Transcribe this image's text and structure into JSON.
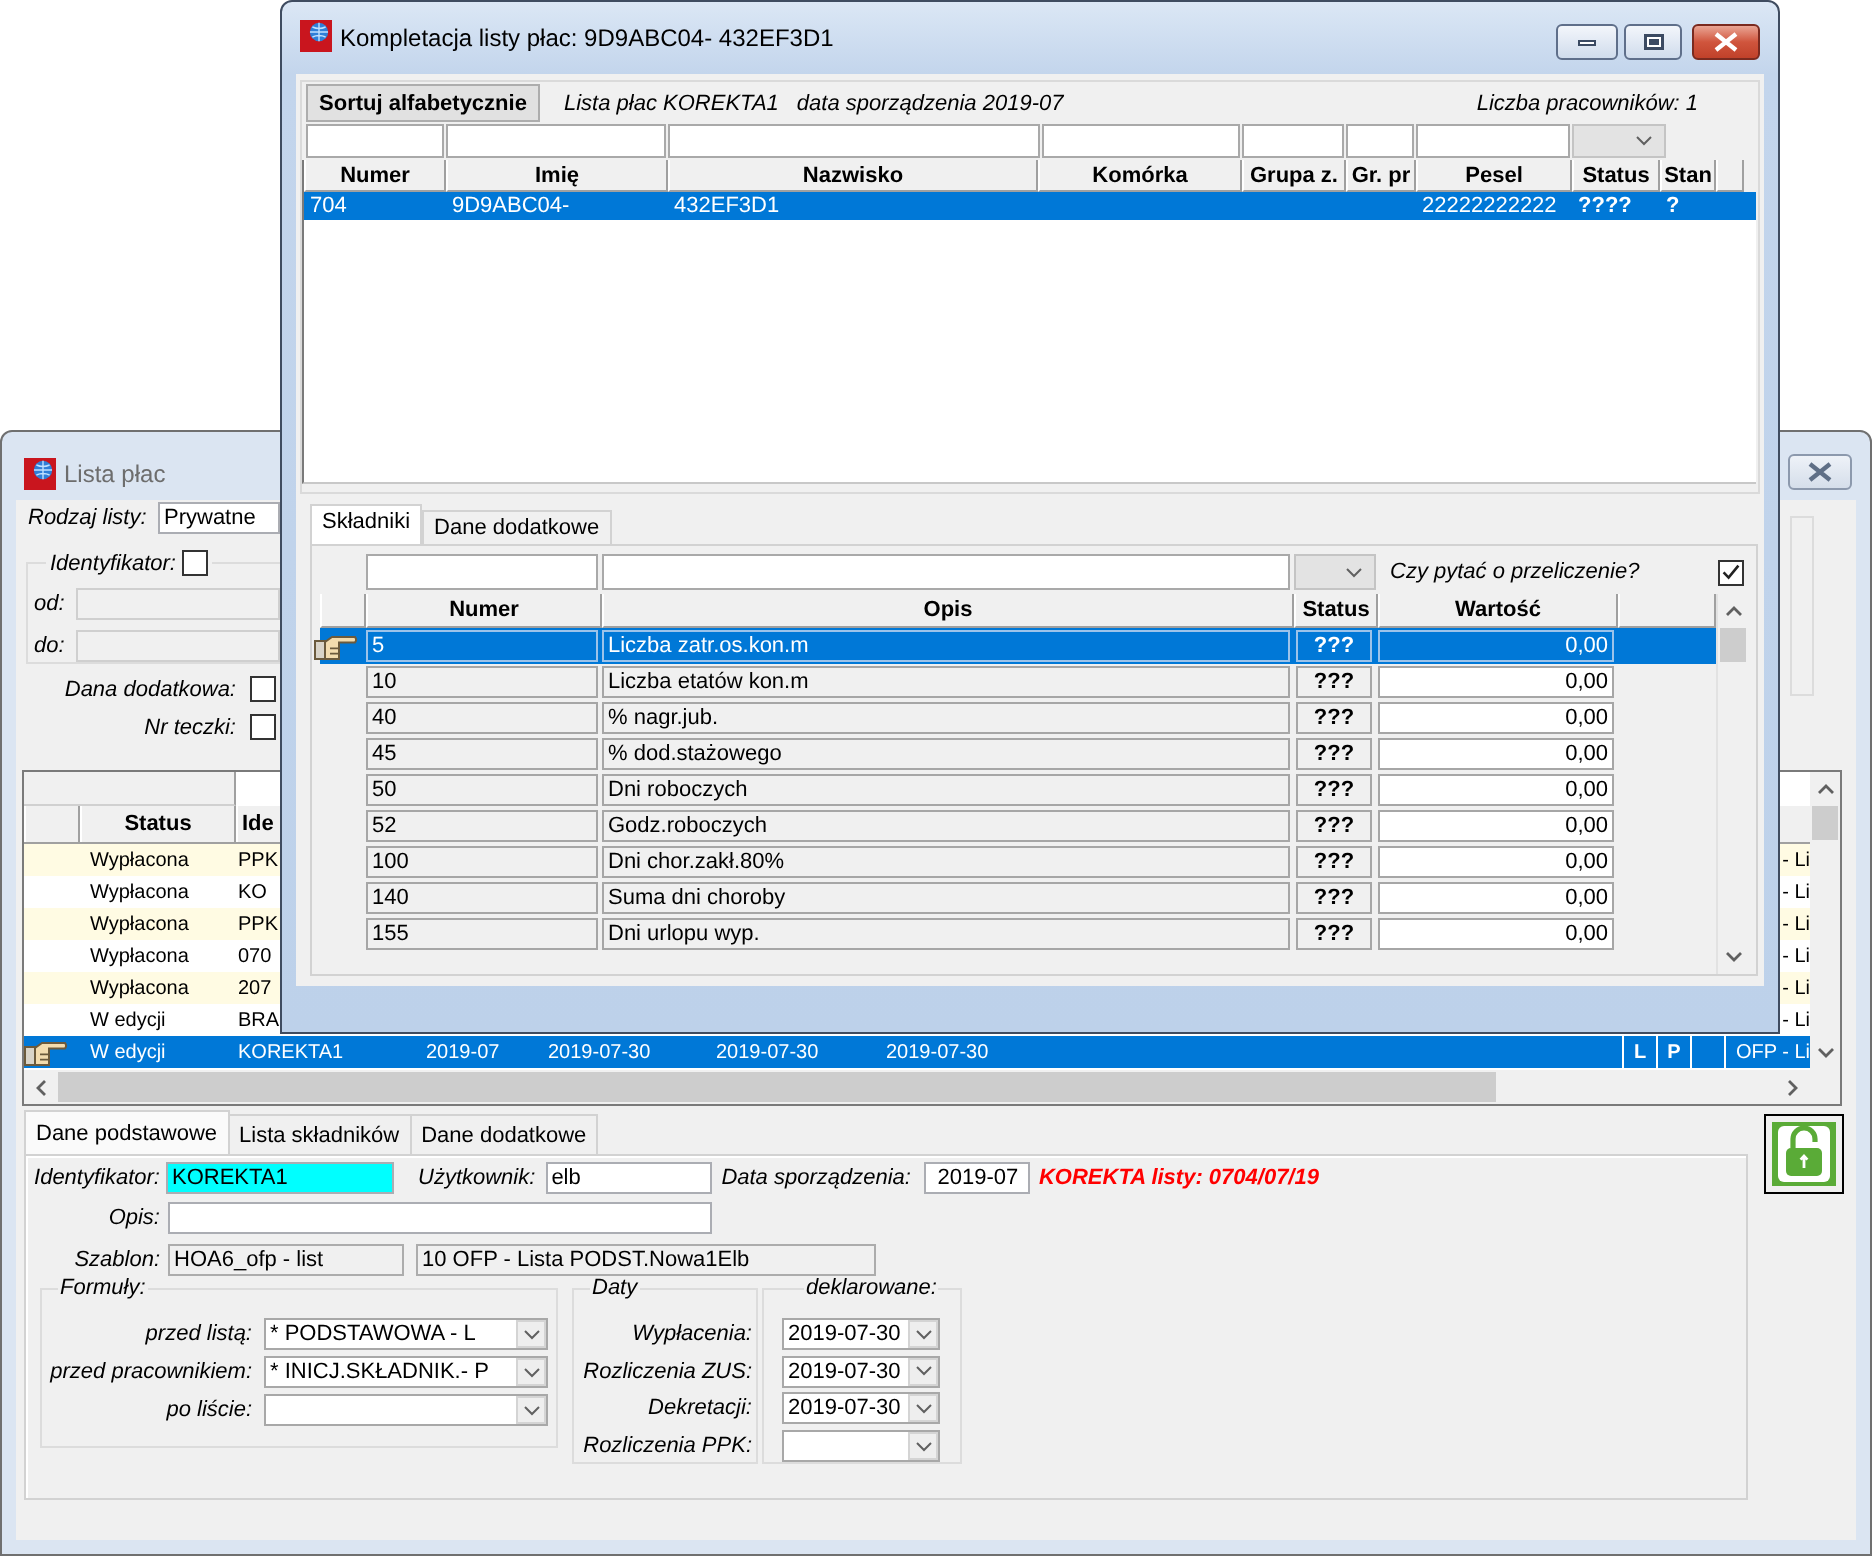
{
  "background_window": {
    "title": "Lista płac",
    "filters": {
      "list_type": {
        "label": "Rodzaj listy:",
        "value": "Prywatne"
      },
      "identifier": {
        "label": "Identyfikator:",
        "checked": false
      },
      "range": [
        {
          "label": "od:"
        },
        {
          "label": "do:"
        }
      ],
      "options": [
        {
          "label": "Dana dodatkowa:",
          "checked": false
        },
        {
          "label": "Nr teczki:",
          "checked": false
        }
      ]
    },
    "table": {
      "columns": [
        "Status",
        "Ide"
      ],
      "rows": [
        {
          "selected": false,
          "cells": [
            "Wypłacona",
            "PPK"
          ],
          "tail": "- Li"
        },
        {
          "selected": false,
          "cells": [
            "Wypłacona",
            "KO"
          ],
          "tail": "- Li"
        },
        {
          "selected": false,
          "cells": [
            "Wypłacona",
            "PPK"
          ],
          "tail": "- Li"
        },
        {
          "selected": false,
          "cells": [
            "Wypłacona",
            "070"
          ],
          "tail": "- Li"
        },
        {
          "selected": false,
          "cells": [
            "Wypłacona",
            "207"
          ],
          "tail": "- Li"
        },
        {
          "selected": false,
          "cells": [
            "W edycji",
            "BRA"
          ],
          "tail": "- Li"
        },
        {
          "selected": true,
          "cells": [
            "W edycji",
            "KOREKTA1",
            "2019-07",
            "2019-07-30",
            "2019-07-30",
            "2019-07-30"
          ],
          "flags": [
            "L",
            "P"
          ],
          "tail": "OFP - Li"
        }
      ]
    },
    "tabs": [
      {
        "label": "Dane podstawowe",
        "selected": true
      },
      {
        "label": "Lista składników",
        "selected": false
      },
      {
        "label": "Dane dodatkowe",
        "selected": false
      }
    ],
    "form": {
      "identifier": {
        "label": "Identyfikator:",
        "value": "KOREKTA1"
      },
      "user": {
        "label": "Użytkownik:",
        "value": "elb"
      },
      "created": {
        "label": "Data sporządzenia:",
        "value": "2019-07"
      },
      "correction_note": "KOREKTA listy: 0704/07/19",
      "description": {
        "label": "Opis:"
      },
      "template": {
        "label": "Szablon:",
        "values": [
          "HOA6_ofp - list",
          "10 OFP - Lista PODST.Nowa1Elb"
        ]
      },
      "formulas": {
        "title": "Formuły:",
        "fields": [
          {
            "label": "przed listą:",
            "value": "* PODSTAWOWA - L"
          },
          {
            "label": "przed pracownikiem:",
            "value": "* INICJ.SKŁADNIK.- P"
          },
          {
            "label": "po liście:"
          }
        ]
      },
      "dates": {
        "title": "Daty",
        "declared_title": "deklarowane:",
        "fields": [
          {
            "label": "Wypłacenia:",
            "value": "2019-07-30"
          },
          {
            "label": "Rozliczenia ZUS:",
            "value": "2019-07-30"
          },
          {
            "label": "Dekretacji:",
            "value": "2019-07-30"
          },
          {
            "label": "Rozliczenia PPK:"
          }
        ]
      }
    },
    "lock": {
      "locked": false
    }
  },
  "dialog": {
    "title": "Kompletacja listy płac: 9D9ABC04- 432EF3D1",
    "sort_button": "Sortuj alfabetycznie",
    "list_info": [
      "Lista płac KOREKTA1",
      "data sporządzenia 2019-07"
    ],
    "employee_count": "Liczba pracowników: 1",
    "employees": {
      "columns": [
        "Numer",
        "Imię",
        "Nazwisko",
        "Komórka",
        "Grupa z.",
        "Gr. pr",
        "Pesel",
        "Status",
        "Stan"
      ],
      "rows": [
        {
          "selected": true,
          "cells": [
            "704",
            "9D9ABC04-",
            "432EF3D1",
            null,
            null,
            null,
            "22222222222",
            "????",
            "?"
          ]
        }
      ]
    },
    "tabs": [
      {
        "label": "Składniki",
        "selected": true
      },
      {
        "label": "Dane dodatkowe",
        "selected": false
      }
    ],
    "recalculate_prompt": {
      "label": "Czy pytać o przeliczenie?",
      "checked": true
    },
    "components": {
      "columns": [
        "Numer",
        "Opis",
        "Status",
        "Wartość"
      ],
      "rows": [
        {
          "selected": true,
          "cells": [
            "5",
            "Liczba zatr.os.kon.m",
            "???",
            "0,00"
          ]
        },
        {
          "selected": false,
          "cells": [
            "10",
            "Liczba etatów kon.m",
            "???",
            "0,00"
          ]
        },
        {
          "selected": false,
          "cells": [
            "40",
            "% nagr.jub.",
            "???",
            "0,00"
          ]
        },
        {
          "selected": false,
          "cells": [
            "45",
            "% dod.stażowego",
            "???",
            "0,00"
          ]
        },
        {
          "selected": false,
          "cells": [
            "50",
            "Dni roboczych",
            "???",
            "0,00"
          ]
        },
        {
          "selected": false,
          "cells": [
            "52",
            "Godz.roboczych",
            "???",
            "0,00"
          ]
        },
        {
          "selected": false,
          "cells": [
            "100",
            "Dni chor.zakł.80%",
            "???",
            "0,00"
          ]
        },
        {
          "selected": false,
          "cells": [
            "140",
            "Suma dni choroby",
            "???",
            "0,00"
          ]
        },
        {
          "selected": false,
          "cells": [
            "155",
            "Dni urlopu wyp.",
            "???",
            "0,00"
          ]
        }
      ]
    }
  }
}
